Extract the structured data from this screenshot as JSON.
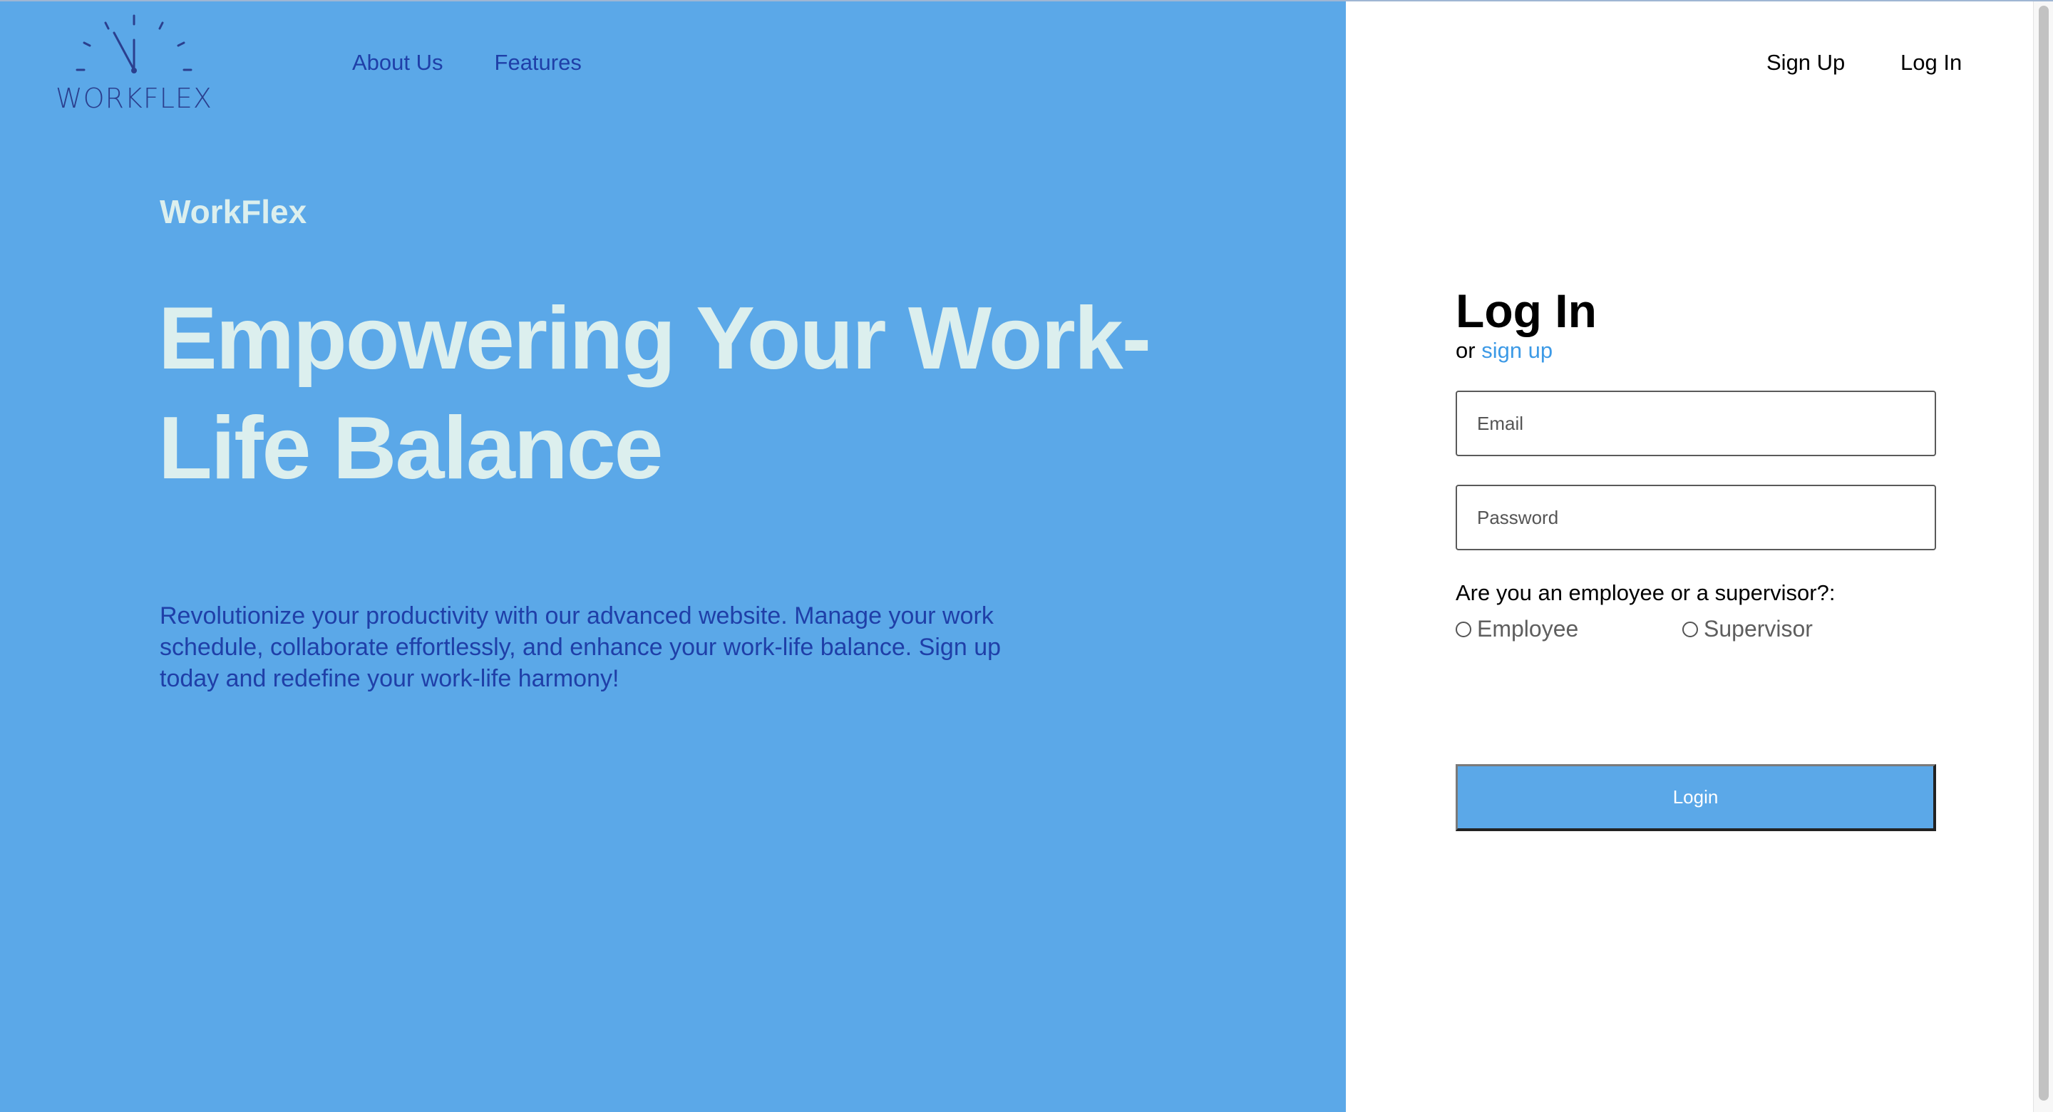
{
  "logo": {
    "text": "WORKFLEX",
    "icon": "clock-dial-icon"
  },
  "nav": {
    "left": [
      "About Us",
      "Features"
    ],
    "signup": "Sign Up",
    "login": "Log In"
  },
  "hero": {
    "brand": "WorkFlex",
    "headline": "Empowering Your Work-Life Balance",
    "description": "Revolutionize your productivity with our advanced website. Manage your work schedule, collaborate effortlessly, and enhance your work-life balance. Sign up today and redefine your work-life harmony!"
  },
  "login_form": {
    "title": "Log In",
    "subtitle_prefix": "or",
    "subtitle_link": "sign up",
    "email_placeholder": "Email",
    "password_placeholder": "Password",
    "role_question": "Are you an employee or a supervisor?:",
    "roles": [
      "Employee",
      "Supervisor"
    ],
    "submit_label": "Login"
  },
  "colors": {
    "hero_background": "#5ba8e8",
    "headline_text": "#dcefee",
    "link_blue": "#1f3fa8",
    "accent_link": "#3d9ae6"
  }
}
